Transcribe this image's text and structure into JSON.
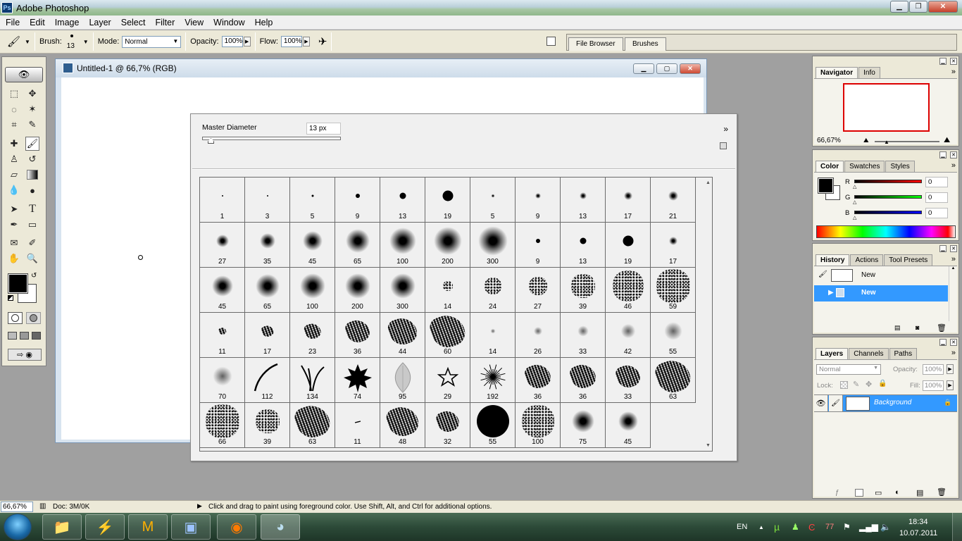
{
  "app": {
    "title": "Adobe Photoshop"
  },
  "menu": [
    "File",
    "Edit",
    "Image",
    "Layer",
    "Select",
    "Filter",
    "View",
    "Window",
    "Help"
  ],
  "options": {
    "brush_label": "Brush:",
    "brush_size": "13",
    "mode_label": "Mode:",
    "mode_value": "Normal",
    "opacity_label": "Opacity:",
    "opacity_value": "100%",
    "flow_label": "Flow:",
    "flow_value": "100%",
    "well_tabs": [
      "File Browser",
      "Brushes"
    ]
  },
  "document": {
    "title": "Untitled-1 @ 66,7% (RGB)"
  },
  "brush_popup": {
    "master_diameter_label": "Master Diameter",
    "master_diameter_value": "13 px",
    "brushes": [
      {
        "size": "1",
        "kind": "hard",
        "d": 2
      },
      {
        "size": "3",
        "kind": "hard",
        "d": 2
      },
      {
        "size": "5",
        "kind": "hard",
        "d": 3
      },
      {
        "size": "9",
        "kind": "hard",
        "d": 6
      },
      {
        "size": "13",
        "kind": "hard",
        "d": 9
      },
      {
        "size": "19",
        "kind": "hard",
        "d": 15
      },
      {
        "size": "5",
        "kind": "soft",
        "d": 5
      },
      {
        "size": "9",
        "kind": "soft",
        "d": 8
      },
      {
        "size": "13",
        "kind": "soft",
        "d": 10
      },
      {
        "size": "17",
        "kind": "soft",
        "d": 12
      },
      {
        "size": "21",
        "kind": "soft",
        "d": 14
      },
      {
        "size": "27",
        "kind": "soft",
        "d": 18
      },
      {
        "size": "35",
        "kind": "soft",
        "d": 22
      },
      {
        "size": "45",
        "kind": "soft",
        "d": 28
      },
      {
        "size": "65",
        "kind": "soft",
        "d": 34
      },
      {
        "size": "100",
        "kind": "soft",
        "d": 38
      },
      {
        "size": "200",
        "kind": "soft",
        "d": 40
      },
      {
        "size": "300",
        "kind": "soft",
        "d": 42
      },
      {
        "size": "9",
        "kind": "hard",
        "d": 6
      },
      {
        "size": "13",
        "kind": "hard",
        "d": 9
      },
      {
        "size": "19",
        "kind": "hard",
        "d": 15
      },
      {
        "size": "17",
        "kind": "soft",
        "d": 12
      },
      {
        "size": "45",
        "kind": "soft",
        "d": 30
      },
      {
        "size": "65",
        "kind": "soft",
        "d": 34
      },
      {
        "size": "100",
        "kind": "soft",
        "d": 36
      },
      {
        "size": "200",
        "kind": "soft",
        "d": 36
      },
      {
        "size": "300",
        "kind": "soft",
        "d": 36
      },
      {
        "size": "14",
        "kind": "scatter",
        "d": 14
      },
      {
        "size": "24",
        "kind": "scatter",
        "d": 24
      },
      {
        "size": "27",
        "kind": "scatter",
        "d": 26
      },
      {
        "size": "39",
        "kind": "scatter",
        "d": 34
      },
      {
        "size": "46",
        "kind": "scatter",
        "d": 44
      },
      {
        "size": "59",
        "kind": "scatter",
        "d": 48
      },
      {
        "size": "11",
        "kind": "chalk",
        "d": 10
      },
      {
        "size": "17",
        "kind": "chalk",
        "d": 16
      },
      {
        "size": "23",
        "kind": "chalk",
        "d": 22
      },
      {
        "size": "36",
        "kind": "chalk",
        "d": 32
      },
      {
        "size": "44",
        "kind": "chalk",
        "d": 38
      },
      {
        "size": "60",
        "kind": "chalk",
        "d": 46
      },
      {
        "size": "14",
        "kind": "star",
        "d": 8
      },
      {
        "size": "26",
        "kind": "star",
        "d": 14
      },
      {
        "size": "33",
        "kind": "star",
        "d": 18
      },
      {
        "size": "42",
        "kind": "star",
        "d": 24
      },
      {
        "size": "55",
        "kind": "star",
        "d": 30
      },
      {
        "size": "70",
        "kind": "star",
        "d": 32
      },
      {
        "size": "112",
        "kind": "grass1",
        "d": 0
      },
      {
        "size": "134",
        "kind": "grass2",
        "d": 0
      },
      {
        "size": "74",
        "kind": "leaf",
        "d": 0
      },
      {
        "size": "95",
        "kind": "leaf2",
        "d": 0
      },
      {
        "size": "29",
        "kind": "staroutline",
        "d": 0
      },
      {
        "size": "192",
        "kind": "burst",
        "d": 0
      },
      {
        "size": "36",
        "kind": "chalk",
        "d": 34
      },
      {
        "size": "36",
        "kind": "chalk",
        "d": 34
      },
      {
        "size": "33",
        "kind": "chalk",
        "d": 32
      },
      {
        "size": "63",
        "kind": "chalk",
        "d": 46
      },
      {
        "size": "66",
        "kind": "scatter",
        "d": 48
      },
      {
        "size": "39",
        "kind": "scatter",
        "d": 34
      },
      {
        "size": "63",
        "kind": "chalk",
        "d": 46
      },
      {
        "size": "11",
        "kind": "dash",
        "d": 0
      },
      {
        "size": "48",
        "kind": "chalk",
        "d": 42
      },
      {
        "size": "32",
        "kind": "chalk",
        "d": 30
      },
      {
        "size": "55",
        "kind": "hard",
        "d": 46
      },
      {
        "size": "100",
        "kind": "scatter",
        "d": 46
      },
      {
        "size": "75",
        "kind": "soft",
        "d": 32
      },
      {
        "size": "45",
        "kind": "soft",
        "d": 28
      }
    ]
  },
  "navigator": {
    "tabs": [
      "Navigator",
      "Info"
    ],
    "zoom": "66,67%"
  },
  "color": {
    "tabs": [
      "Color",
      "Swatches",
      "Styles"
    ],
    "channels": [
      {
        "name": "R",
        "value": "0",
        "color": "#ff0000"
      },
      {
        "name": "G",
        "value": "0",
        "color": "#00ff00"
      },
      {
        "name": "B",
        "value": "0",
        "color": "#0000ff"
      }
    ]
  },
  "history": {
    "tabs": [
      "History",
      "Actions",
      "Tool Presets"
    ],
    "snapshot": "New",
    "state": "New"
  },
  "layers": {
    "tabs": [
      "Layers",
      "Channels",
      "Paths"
    ],
    "blend_mode": "Normal",
    "opacity_label": "Opacity:",
    "opacity_value": "100%",
    "lock_label": "Lock:",
    "fill_label": "Fill:",
    "fill_value": "100%",
    "layer_name": "Background"
  },
  "status": {
    "zoom": "66,67%",
    "doc": "Doc: 3M/0K",
    "hint": "Click and drag to paint using foreground color.  Use Shift, Alt, and Ctrl for additional options."
  },
  "taskbar": {
    "lang": "EN",
    "utorrent_count": "77",
    "time": "18:34",
    "date": "10.07.2011"
  }
}
